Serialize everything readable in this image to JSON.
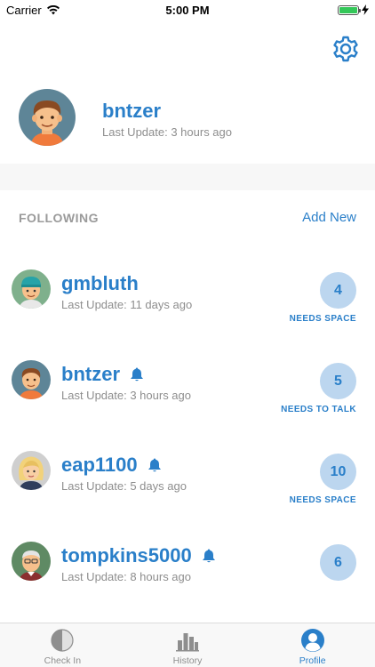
{
  "status_bar": {
    "carrier": "Carrier",
    "time": "5:00 PM",
    "battery_level": 1.0
  },
  "settings": {
    "icon": "gear-icon"
  },
  "profile": {
    "username": "bntzer",
    "last_update": "Last Update: 3 hours ago",
    "avatar_icon": "boy-avatar-icon"
  },
  "following": {
    "title": "FOLLOWING",
    "add_new": "Add New",
    "items": [
      {
        "username": "gmbluth",
        "last_update": "Last Update: 11 days ago",
        "score": "4",
        "status": "NEEDS SPACE",
        "notify": false,
        "avatar_icon": "cap-avatar-icon"
      },
      {
        "username": "bntzer",
        "last_update": "Last Update: 3 hours ago",
        "score": "5",
        "status": "NEEDS TO TALK",
        "notify": true,
        "avatar_icon": "boy-avatar-icon"
      },
      {
        "username": "eap1100",
        "last_update": "Last Update: 5 days ago",
        "score": "10",
        "status": "NEEDS SPACE",
        "notify": true,
        "avatar_icon": "blonde-avatar-icon"
      },
      {
        "username": "tompkins5000",
        "last_update": "Last Update: 8 hours ago",
        "score": "6",
        "status": "",
        "notify": true,
        "avatar_icon": "elder-avatar-icon"
      }
    ]
  },
  "tabs": [
    {
      "label": "Check In",
      "icon": "half-circle-icon",
      "active": false
    },
    {
      "label": "History",
      "icon": "bar-chart-icon",
      "active": false
    },
    {
      "label": "Profile",
      "icon": "person-icon",
      "active": true
    }
  ],
  "colors": {
    "accent": "#2a7fc9",
    "badge_bg": "#bcd6ef",
    "muted_text": "#8e8e8e",
    "battery": "#34c759"
  }
}
